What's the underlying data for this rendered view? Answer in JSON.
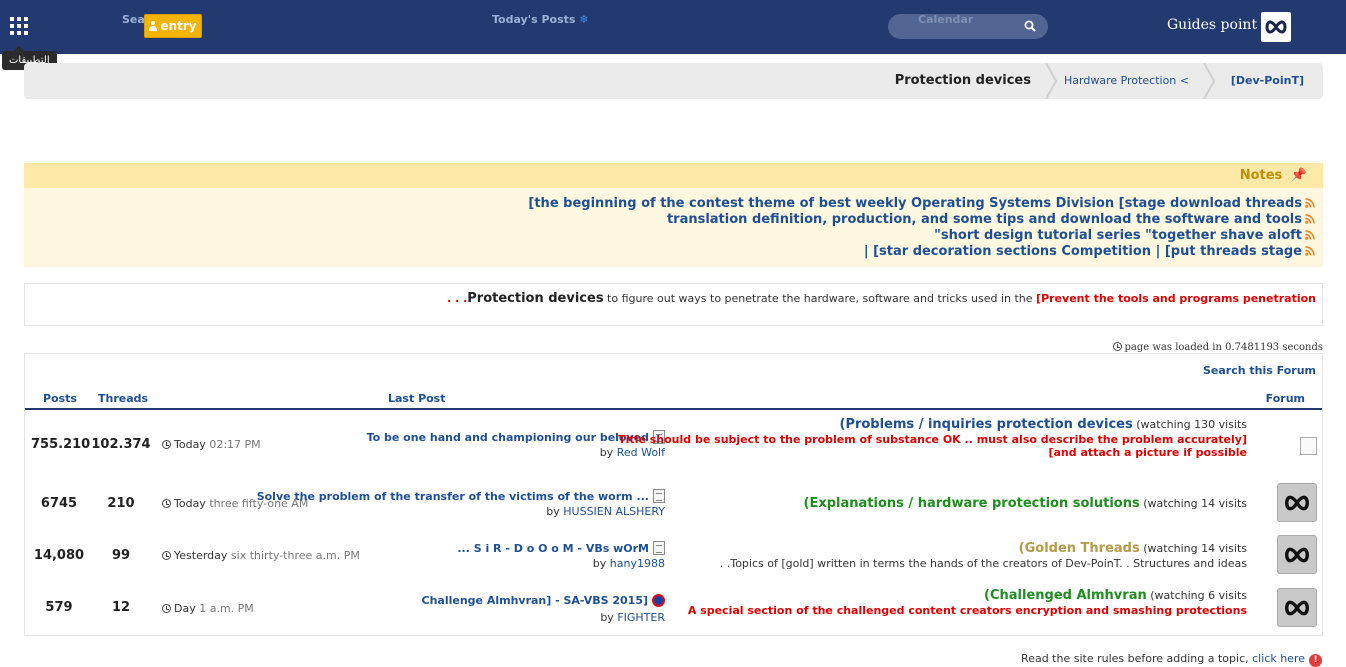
{
  "topbar": {
    "apps_tooltip": "التطبيقات",
    "nav_search": "Sea",
    "nav_todays_posts": "Today's Posts",
    "nav_calendar": "Calendar",
    "entry_label": "entry",
    "brand_name": "Guides point"
  },
  "breadcrumb": {
    "root": "[Dev-PoinT]",
    "parent": "Hardware Protection <",
    "current": "Protection devices"
  },
  "notes": {
    "title": "Notes",
    "items": [
      "[the beginning of the contest theme of best weekly Operating Systems Division [stage download threads",
      "translation definition, production, and some tips and download the software and tools",
      "\"short design tutorial series \"together shave aloft",
      "| [star decoration sections Competition | [put threads stage"
    ]
  },
  "description": {
    "red": "[Prevent the tools and programs penetration",
    "black": " to figure out ways to penetrate the hardware, software and tricks used in the ",
    "bold": "Protection devices",
    "dots": ". . ."
  },
  "load_time": "page was loaded in 0.7481193 seconds",
  "search_forum": "Search this Forum",
  "columns": {
    "posts": "Posts",
    "threads": "Threads",
    "last_post": "Last Post",
    "forum": "Forum"
  },
  "rows": [
    {
      "posts": "755.210",
      "threads": "102.374",
      "time_day": "Today",
      "time_value": "02:17 PM",
      "lp_title": "To be one hand and championing our beloved",
      "lp_by": "by",
      "lp_user": "Red Wolf",
      "forum_name": "Problems / inquiries protection devices",
      "forum_open": "(",
      "visits": " (watching 130 visits",
      "desc": "Title should be subject to the problem of substance OK .. must also describe the problem accurately]",
      "desc2": "[and attach a picture if possible",
      "name_color": "#1e4f92",
      "desc_color": "#e00000"
    },
    {
      "posts": "6745",
      "threads": "210",
      "time_day": "Today",
      "time_value": "three fifty-one AM",
      "lp_title": "Solve the problem of the transfer of the victims of the worm ...",
      "lp_by": "by",
      "lp_user": "HUSSIEN ALSHERY",
      "forum_name": "Explanations / hardware protection solutions",
      "forum_open": "(",
      "visits": " (watching 14 visits",
      "desc": "",
      "desc2": "",
      "name_color": "#1e8e1e",
      "desc_color": "#333333"
    },
    {
      "posts": "14,080",
      "threads": "99",
      "time_day": "Yesterday",
      "time_value": "six thirty-three a.m. PM",
      "lp_title": "... S i R - D o O o M - VBs wOrM",
      "lp_by": "by",
      "lp_user": "hany1988",
      "forum_name": "Golden Threads",
      "forum_open": "(",
      "visits": " (watching 14 visits",
      "desc": ". .Topics of [gold] written in terms the hands of the creators of Dev-PoinT. . Structures and ideas",
      "desc2": "",
      "name_color": "#b39b4a",
      "desc_color": "#333333"
    },
    {
      "posts": "579",
      "threads": "12",
      "time_day": "Day",
      "time_value": "1 a.m. PM",
      "lp_title": "Challenge Almhvran] - SA-VBS 2015]",
      "lp_by": "by",
      "lp_user": "FIGHTER",
      "forum_name": "Challenged Almhvran",
      "forum_open": "(",
      "visits": " (watching 6 visits",
      "desc": "A special section of the challenged content creators encryption and smashing protections",
      "desc2": "",
      "name_color": "#1e8e1e",
      "desc_color": "#e00000"
    }
  ],
  "rules": {
    "text": "Read the site rules before adding a topic,",
    "link": "click here"
  },
  "colors": {
    "topbar": "#233a70",
    "accent": "#f4b400",
    "link": "#1e4f92",
    "alert": "#e00000"
  }
}
